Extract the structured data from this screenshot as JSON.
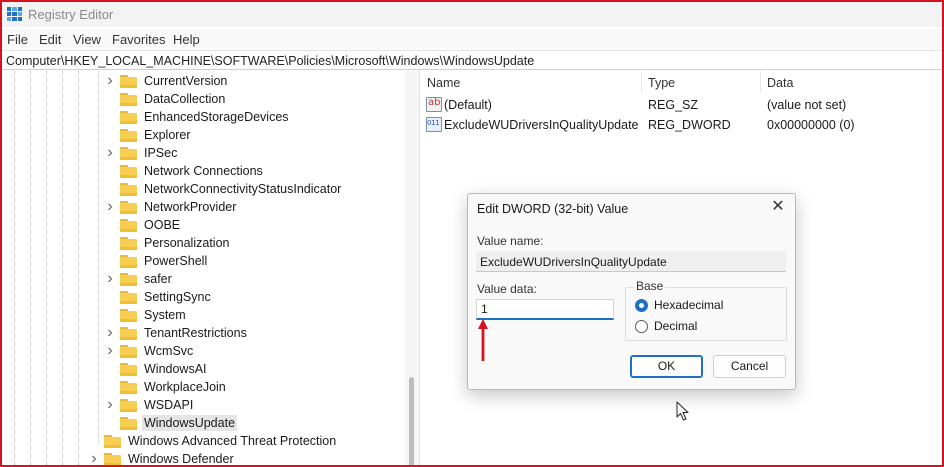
{
  "window": {
    "title": "Registry Editor"
  },
  "menu": [
    "File",
    "Edit",
    "View",
    "Favorites",
    "Help"
  ],
  "address": "Computer\\HKEY_LOCAL_MACHINE\\SOFTWARE\\Policies\\Microsoft\\Windows\\WindowsUpdate",
  "tree": {
    "items": [
      {
        "label": "CurrentVersion",
        "expandable": true,
        "level": 2
      },
      {
        "label": "DataCollection",
        "expandable": false,
        "level": 2
      },
      {
        "label": "EnhancedStorageDevices",
        "expandable": false,
        "level": 2
      },
      {
        "label": "Explorer",
        "expandable": false,
        "level": 2
      },
      {
        "label": "IPSec",
        "expandable": true,
        "level": 2
      },
      {
        "label": "Network Connections",
        "expandable": false,
        "level": 2
      },
      {
        "label": "NetworkConnectivityStatusIndicator",
        "expandable": false,
        "level": 2
      },
      {
        "label": "NetworkProvider",
        "expandable": true,
        "level": 2
      },
      {
        "label": "OOBE",
        "expandable": false,
        "level": 2
      },
      {
        "label": "Personalization",
        "expandable": false,
        "level": 2
      },
      {
        "label": "PowerShell",
        "expandable": false,
        "level": 2
      },
      {
        "label": "safer",
        "expandable": true,
        "level": 2
      },
      {
        "label": "SettingSync",
        "expandable": false,
        "level": 2
      },
      {
        "label": "System",
        "expandable": false,
        "level": 2
      },
      {
        "label": "TenantRestrictions",
        "expandable": true,
        "level": 2
      },
      {
        "label": "WcmSvc",
        "expandable": true,
        "level": 2
      },
      {
        "label": "WindowsAI",
        "expandable": false,
        "level": 2
      },
      {
        "label": "WorkplaceJoin",
        "expandable": false,
        "level": 2
      },
      {
        "label": "WSDAPI",
        "expandable": true,
        "level": 2
      },
      {
        "label": "WindowsUpdate",
        "expandable": false,
        "level": 2,
        "selected": true
      },
      {
        "label": "Windows Advanced Threat Protection",
        "expandable": false,
        "level": 1
      },
      {
        "label": "Windows Defender",
        "expandable": true,
        "level": 1
      }
    ]
  },
  "list": {
    "columns": [
      "Name",
      "Type",
      "Data"
    ],
    "rows": [
      {
        "icon": "string-value-icon",
        "name": "(Default)",
        "type": "REG_SZ",
        "data": "(value not set)"
      },
      {
        "icon": "dword-value-icon",
        "name": "ExcludeWUDriversInQualityUpdate",
        "type": "REG_DWORD",
        "data": "0x00000000 (0)"
      }
    ]
  },
  "dialog": {
    "title": "Edit DWORD (32-bit) Value",
    "value_name_label": "Value name:",
    "value_name": "ExcludeWUDriversInQualityUpdate",
    "value_data_label": "Value data:",
    "value_data": "1",
    "base_label": "Base",
    "base_options": [
      {
        "label": "Hexadecimal",
        "selected": true
      },
      {
        "label": "Decimal",
        "selected": false
      }
    ],
    "ok_label": "OK",
    "cancel_label": "Cancel"
  },
  "colors": {
    "accent": "#1f6fc5",
    "annotation": "#d6121f",
    "folder": "#f7cd52"
  }
}
